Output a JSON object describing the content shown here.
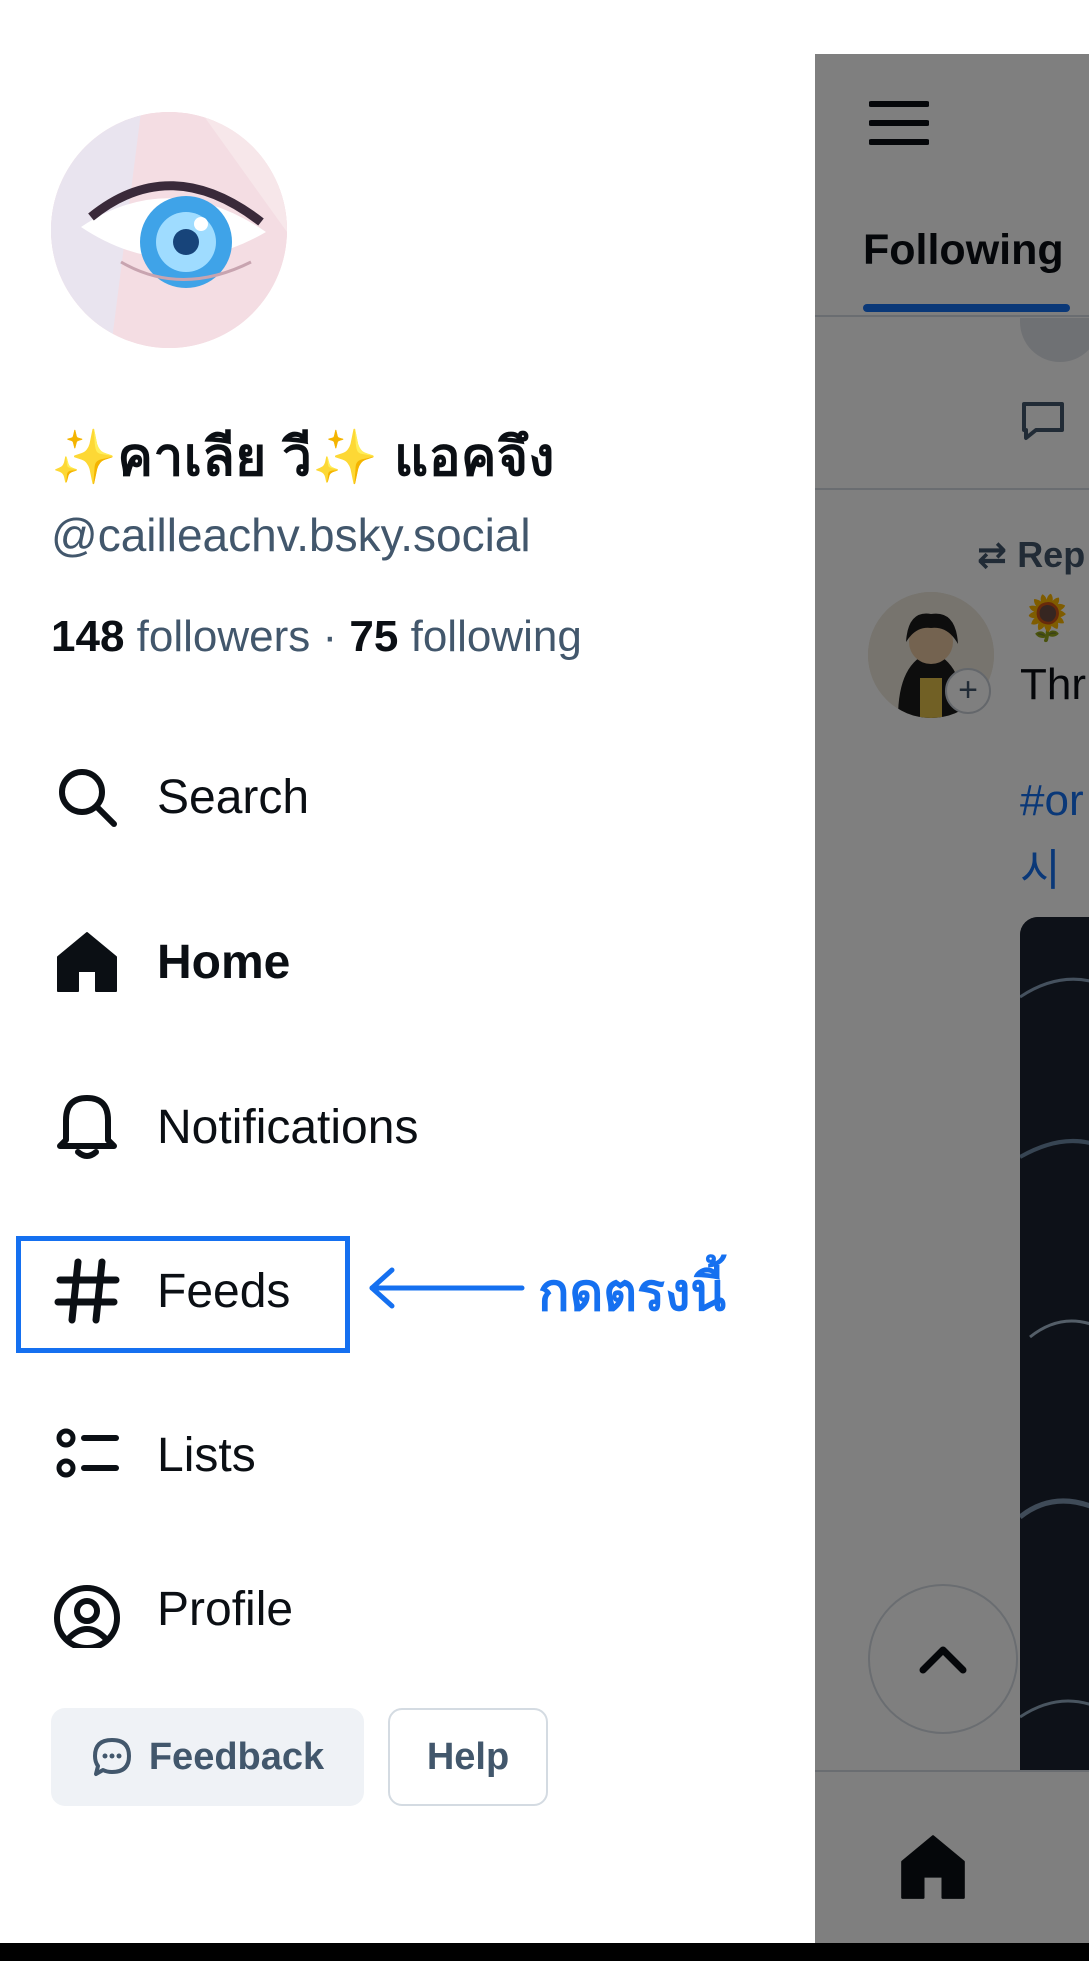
{
  "profile": {
    "display_name": "✨คาเลีย วี✨ แอคจึง",
    "handle": "@cailleachv.bsky.social",
    "followers_count": "148",
    "followers_label": "followers",
    "separator": "·",
    "following_count": "75",
    "following_label": "following"
  },
  "nav": {
    "search": "Search",
    "home": "Home",
    "notifications": "Notifications",
    "feeds": "Feeds",
    "lists": "Lists",
    "profile": "Profile"
  },
  "annotation": {
    "text": "กดตรงนี้",
    "color": "#1570f0"
  },
  "footer": {
    "feedback_label": "Feedback",
    "help_label": "Help"
  },
  "main": {
    "tab_following": "Following",
    "repost_label": "Rep",
    "post_text_fragment": "Thr",
    "post_tag_fragment": "#or",
    "post_tag_fragment2": "시"
  },
  "icons": {
    "search": "search-icon",
    "home": "home-icon",
    "notifications": "bell-icon",
    "feeds": "hashtag-icon",
    "lists": "list-icon",
    "profile": "user-circle-icon",
    "feedback": "chat-bubble-icon",
    "menu": "hamburger-icon",
    "scroll_top": "chevron-up-icon"
  },
  "colors": {
    "accent": "#1570f0",
    "muted_text": "#42576c",
    "primary_text": "#0b0f14"
  }
}
